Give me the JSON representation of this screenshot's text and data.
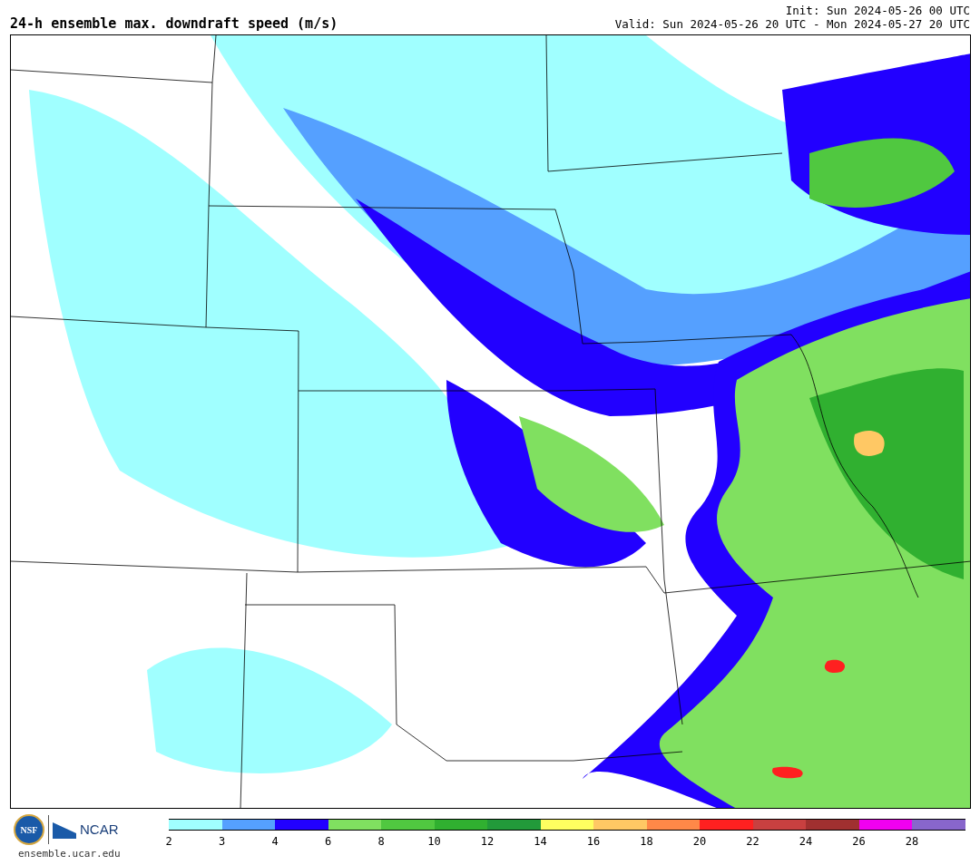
{
  "title": "24-h ensemble max. downdraft speed (m/s)",
  "init": "Init: Sun 2024-05-26 00 UTC",
  "valid": "Valid: Sun 2024-05-26 20 UTC - Mon 2024-05-27 20 UTC",
  "logos": {
    "nsf": "NSF",
    "ncar": "NCAR",
    "site": "ensemble.ucar.edu"
  },
  "colorbar": [
    {
      "color": "#a0ffff",
      "label": "2"
    },
    {
      "color": "#55a0ff",
      "label": "3"
    },
    {
      "color": "#2200ff",
      "label": "4"
    },
    {
      "color": "#80e060",
      "label": "6"
    },
    {
      "color": "#50c840",
      "label": "8"
    },
    {
      "color": "#30b030",
      "label": "10"
    },
    {
      "color": "#229a3a",
      "label": "12"
    },
    {
      "color": "#ffff60",
      "label": "14"
    },
    {
      "color": "#ffc864",
      "label": "16"
    },
    {
      "color": "#ff8848",
      "label": "18"
    },
    {
      "color": "#ff2020",
      "label": "20"
    },
    {
      "color": "#c84040",
      "label": "22"
    },
    {
      "color": "#a03030",
      "label": "24"
    },
    {
      "color": "#f000f0",
      "label": "26"
    },
    {
      "color": "#8866cc",
      "label": "28"
    }
  ]
}
